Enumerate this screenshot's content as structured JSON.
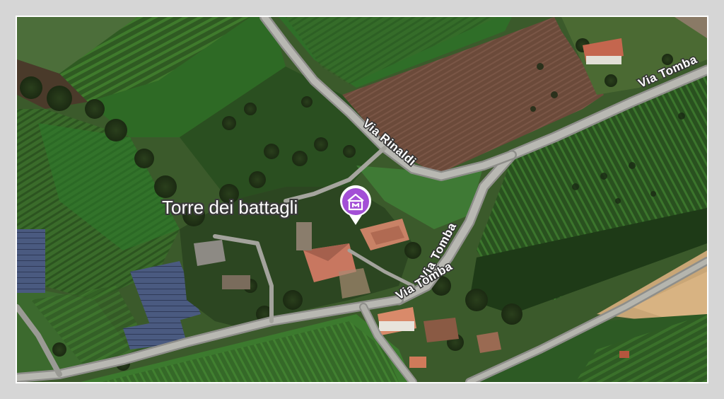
{
  "map": {
    "view": "satellite",
    "place": {
      "name": "Torre dei battagli",
      "icon": "museum-icon",
      "pin_color": "#a34fd6"
    },
    "roads": [
      {
        "name": "Via Tomba"
      },
      {
        "name": "Via Rinaldi"
      },
      {
        "name": "Via Tomba"
      },
      {
        "name": "Via Tomba"
      }
    ]
  }
}
